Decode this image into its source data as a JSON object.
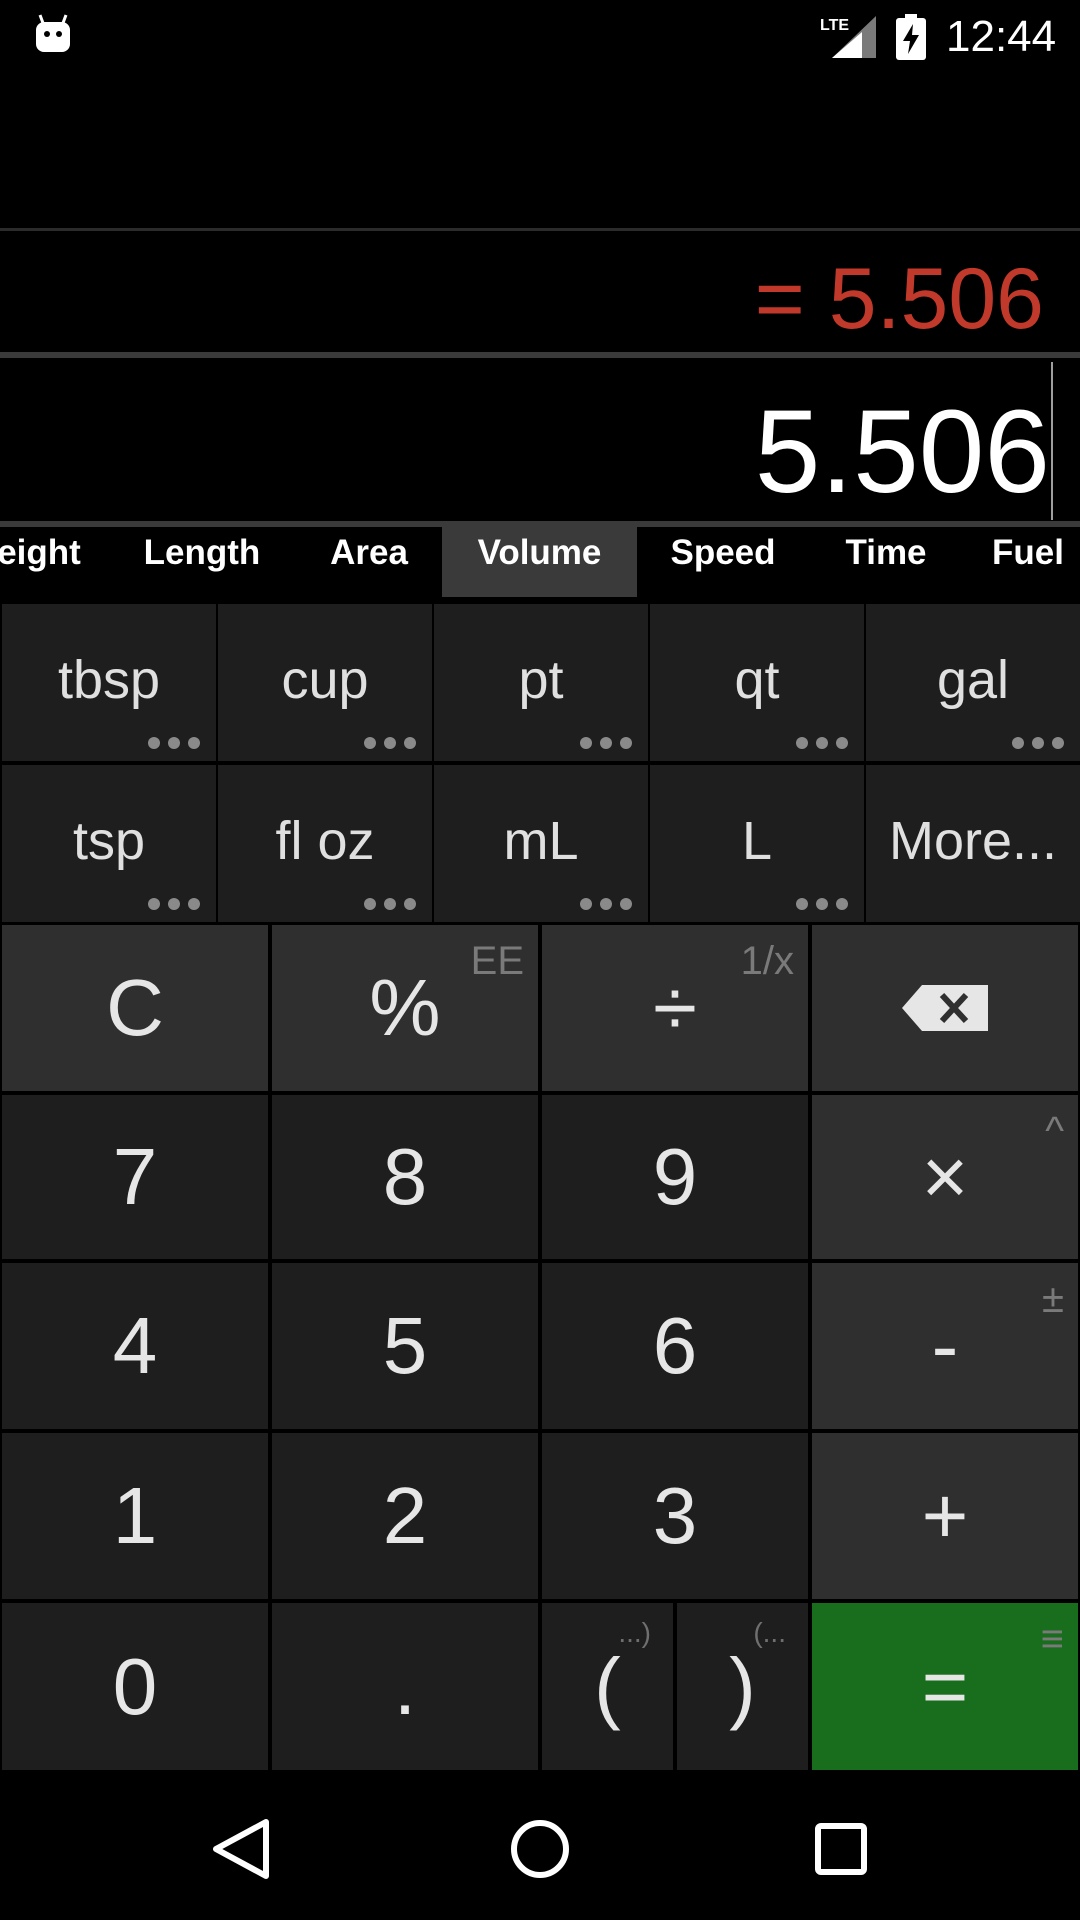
{
  "status_bar": {
    "time": "12:44",
    "network": "LTE"
  },
  "display": {
    "result": "= 5.506",
    "expression": "5.506"
  },
  "categories": {
    "tabs": [
      "eight",
      "Length",
      "Area",
      "Volume",
      "Speed",
      "Time",
      "Fuel"
    ],
    "active": "Volume"
  },
  "units": {
    "row1": [
      "tbsp",
      "cup",
      "pt",
      "qt",
      "gal"
    ],
    "row2": [
      "tsp",
      "fl oz",
      "mL",
      "L",
      "More..."
    ]
  },
  "keypad": {
    "clear": "C",
    "percent": "%",
    "percent_sub": "EE",
    "divide": "÷",
    "divide_sub": "1/x",
    "seven": "7",
    "eight": "8",
    "nine": "9",
    "multiply": "×",
    "multiply_sub": "^",
    "four": "4",
    "five": "5",
    "six": "6",
    "minus": "-",
    "minus_sub": "±",
    "one": "1",
    "two": "2",
    "three": "3",
    "plus": "+",
    "zero": "0",
    "decimal": ".",
    "open_paren": "(",
    "open_paren_sub": "...)",
    "close_paren": ")",
    "close_paren_sub": "(...",
    "equals": "=",
    "equals_sub": "≡"
  },
  "colors": {
    "result": "#c0392b",
    "equals_key": "#186e1c",
    "active_tab": "#3a3a3a",
    "key": "#1e1e1e",
    "function_key": "#2f2f2f"
  }
}
